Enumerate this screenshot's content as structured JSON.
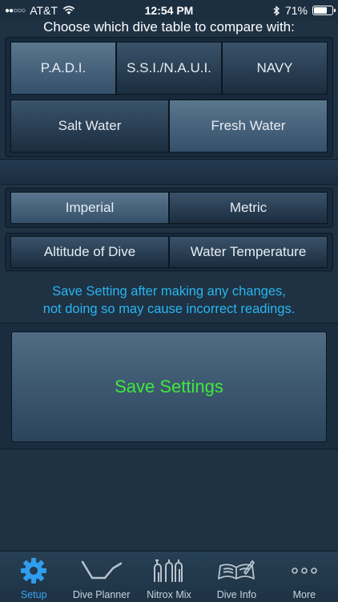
{
  "status_bar": {
    "carrier": "AT&T",
    "time": "12:54 PM",
    "battery": "71%",
    "battery_level": 0.71
  },
  "heading": "Choose which dive table to compare with:",
  "dive_tables": [
    {
      "label": "P.A.D.I.",
      "selected": true
    },
    {
      "label": "S.S.I./N.A.U.I.",
      "selected": false
    },
    {
      "label": "NAVY",
      "selected": false
    }
  ],
  "water_types": [
    {
      "label": "Salt Water",
      "selected": false
    },
    {
      "label": "Fresh Water",
      "selected": true
    }
  ],
  "units": [
    {
      "label": "Imperial",
      "selected": true
    },
    {
      "label": "Metric",
      "selected": false
    }
  ],
  "options": [
    {
      "label": "Altitude of Dive"
    },
    {
      "label": "Water Temperature"
    }
  ],
  "warning": {
    "line1": "Save Setting after making any changes,",
    "line2": "not doing so may cause incorrect readings."
  },
  "save_button": "Save Settings",
  "tabs": [
    {
      "label": "Setup",
      "icon": "gear-icon",
      "active": true
    },
    {
      "label": "Dive Planner",
      "icon": "dive-profile-icon",
      "active": false
    },
    {
      "label": "Nitrox Mix",
      "icon": "tanks-icon",
      "active": false
    },
    {
      "label": "Dive Info",
      "icon": "book-icon",
      "active": false
    },
    {
      "label": "More",
      "icon": "more-icon",
      "active": false
    }
  ],
  "colors": {
    "accent": "#3aa6f2",
    "warning_text": "#2ab5ee",
    "save_text": "#3ee83a",
    "background": "#1e3244"
  }
}
